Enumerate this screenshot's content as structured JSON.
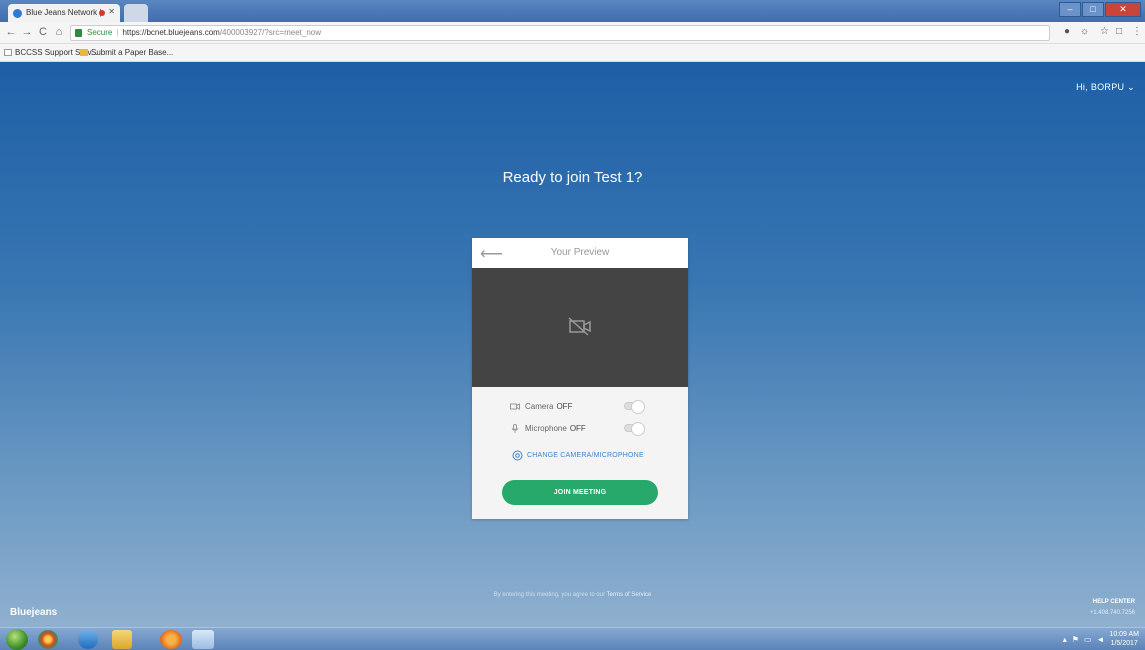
{
  "browser": {
    "tab_title": "Blue Jeans Network |",
    "url_secure": "Secure",
    "url_host": "https://bcnet.bluejeans.com",
    "url_path": "/400003927/?src=meet_now",
    "bookmarks": [
      "BCCSS Support Serv...",
      "Submit a Paper Base..."
    ]
  },
  "page": {
    "user_menu": "Hi, BORPU",
    "headline_prefix": "Ready to join ",
    "meeting_name": "Test 1?",
    "card_title": "Your Preview",
    "camera_label": "Camera",
    "camera_state": "OFF",
    "mic_label": "Microphone",
    "mic_state": "OFF",
    "change_link": "CHANGE CAMERA/MICROPHONE",
    "join_button": "JOIN MEETING",
    "terms_prefix": "By entering this meeting, you agree to our",
    "terms_link": "Terms of Service",
    "brand": "Bluejeans",
    "help_label": "HELP CENTER",
    "help_phone": "+1.408.740.7256"
  },
  "taskbar": {
    "time": "10:09 AM",
    "date": "1/5/2017"
  }
}
